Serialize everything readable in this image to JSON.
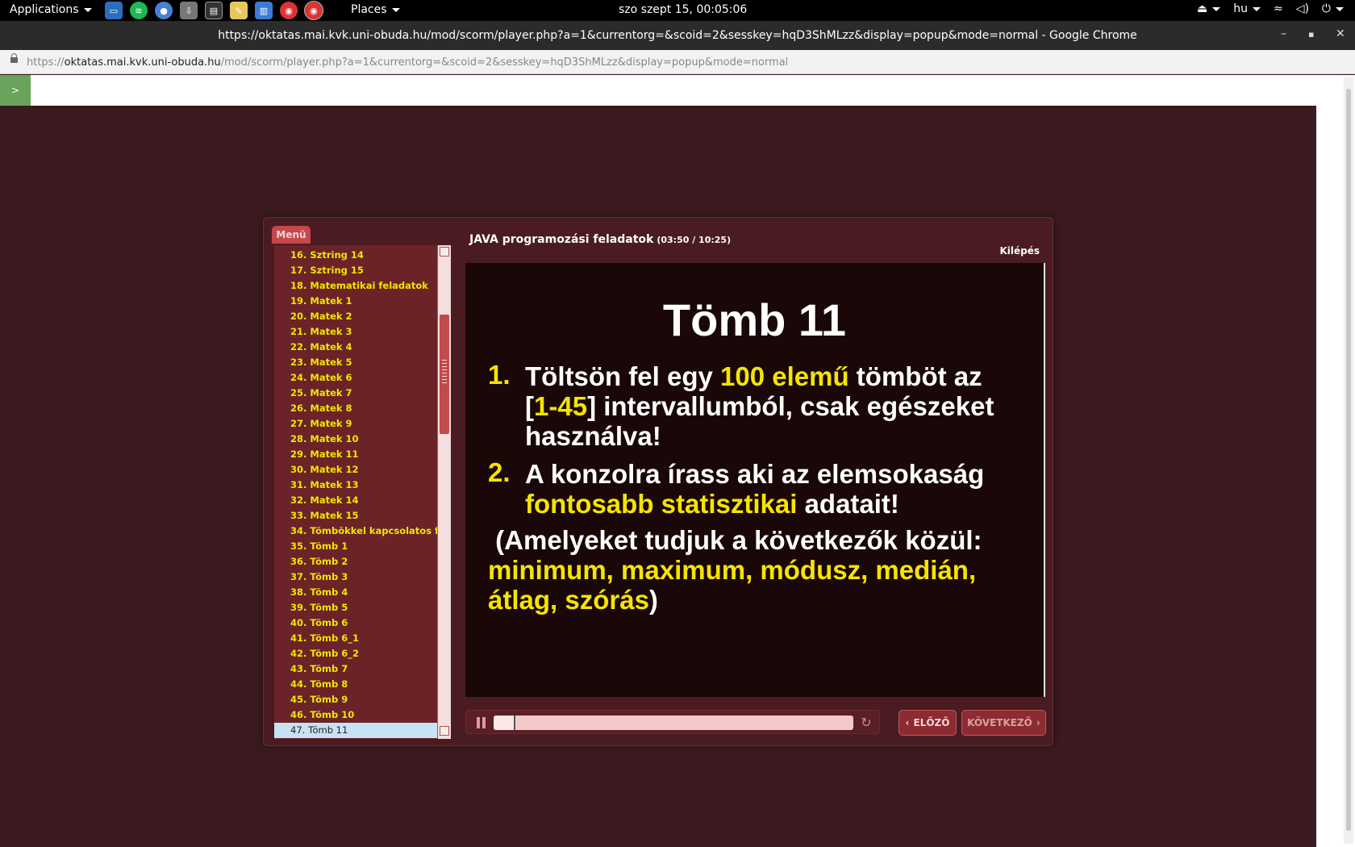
{
  "taskbar": {
    "applications_label": "Applications",
    "places_label": "Places",
    "clock": "szo szept 15, 00:05:06",
    "keyboard_layout": "hu",
    "launchers": [
      "files-icon",
      "spotify-icon",
      "chromium-icon",
      "installer-icon",
      "terminal-icon",
      "text-editor-icon",
      "system-monitor-icon",
      "chrome-icon",
      "chrome-active-icon"
    ]
  },
  "window": {
    "title": "https://oktatas.mai.kvk.uni-obuda.hu/mod/scorm/player.php?a=1&currentorg=&scoid=2&sesskey=hqD3ShMLzz&display=popup&mode=normal - Google Chrome"
  },
  "address_bar": {
    "scheme": "https://",
    "host": "oktatas.mai.kvk.uni-obuda.hu",
    "path": "/mod/scorm/player.php?a=1&currentorg=&scoid=2&sesskey=hqD3ShMLzz&display=popup&mode=normal"
  },
  "page": {
    "toggle_button_label": ">"
  },
  "player": {
    "menu_tab_label": "Menü",
    "course_title": "JAVA programozási feladatok",
    "time": "(03:50 / 10:25)",
    "exit_label": "Kilépés",
    "prev_label": "ELŐZŐ",
    "next_label": "KÖVETKEZŐ",
    "progress_fraction": 0.06,
    "menu_items": [
      "16. Sztring 14",
      "17. Sztring 15",
      "18. Matematikai feladatok",
      "19. Matek 1",
      "20. Matek 2",
      "21. Matek 3",
      "22. Matek 4",
      "23. Matek 5",
      "24. Matek 6",
      "25. Matek 7",
      "26. Matek 8",
      "27. Matek 9",
      "28. Matek 10",
      "29. Matek 11",
      "30. Matek 12",
      "31. Matek 13",
      "32. Matek 14",
      "33. Matek 15",
      "34. Tömbökkel kapcsolatos f...",
      "35. Tömb 1",
      "36. Tömb 2",
      "37. Tömb 3",
      "38. Tömb 4",
      "39. Tömb 5",
      "40. Tömb 6",
      "41. Tömb 6_1",
      "42. Tömb 6_2",
      "43. Tömb 7",
      "44. Tömb 8",
      "45. Tömb 9",
      "46. Tömb 10",
      "47. Tömb 11"
    ],
    "selected_menu_index": 31
  },
  "slide": {
    "title": "Tömb 11",
    "item1_number": "1.",
    "item1_a": "Töltsön fel egy ",
    "item1_b": "100 elemű",
    "item1_c": " tömböt az",
    "item1_d": "[",
    "item1_e": "1-45",
    "item1_f": "] intervallumból, csak egészeket",
    "item1_g": "használva!",
    "item2_number": "2.",
    "item2_a": "A konzolra írass aki az elemsokaság",
    "item2_b": "fontosabb statisztikai",
    "item2_c": " adatait!",
    "note_a": " (Amelyeket tudjuk a következők közül:",
    "note_b": "minimum, maximum, módusz, medián,",
    "note_c": "átlag, szórás",
    "note_d": ")"
  },
  "colors": {
    "page_background": "#3b1a1f",
    "menu_item_text": "#f2e600",
    "slide_highlight": "#f5e400",
    "selected_item_bg": "#c6e2f5"
  }
}
